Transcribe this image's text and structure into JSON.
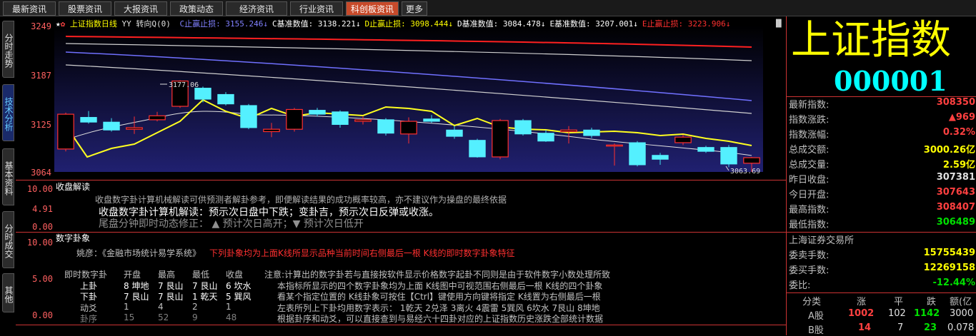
{
  "tabs": [
    {
      "label": "最新资讯"
    },
    {
      "label": "股票资讯"
    },
    {
      "label": "大报资讯"
    },
    {
      "label": "政策动态"
    },
    {
      "label": "经济资讯"
    },
    {
      "label": "行业资讯"
    },
    {
      "label": "科创板资讯"
    },
    {
      "label": "更多"
    }
  ],
  "side_tabs": [
    {
      "label": "分时走势"
    },
    {
      "label": "技术分析"
    },
    {
      "label": "基本资料"
    },
    {
      "label": "分时成交"
    },
    {
      "label": "其他"
    }
  ],
  "chart": {
    "title": "上证指数日线",
    "yy": "YY",
    "turn": "转向Q(0)",
    "legend": [
      {
        "label": "C止赢止损:",
        "value": "3155.246↓",
        "color": "#8080ff"
      },
      {
        "label": "C基准数值:",
        "value": "3138.221↓",
        "color": "#ffffff"
      },
      {
        "label": "D止赢止损:",
        "value": "3098.444↓",
        "color": "#ffff00"
      },
      {
        "label": "D基准数值:",
        "value": "3084.478↓",
        "color": "#ffffff"
      },
      {
        "label": "E基准数值:",
        "value": "3207.001↓",
        "color": "#ffffff"
      },
      {
        "label": "E止赢止损:",
        "value": "3223.906↓",
        "color": "#ff3030"
      }
    ],
    "y_ticks": [
      "3249",
      "3187",
      "3125",
      "3064"
    ],
    "high_label": "3177.06",
    "low_label": "3063.69"
  },
  "chart_data": {
    "type": "candlestick",
    "ylim": [
      3064,
      3249
    ],
    "candles": [
      {
        "o": 3093,
        "c": 3137,
        "h": 3139,
        "l": 3090
      },
      {
        "o": 3133,
        "c": 3127,
        "h": 3141,
        "l": 3125
      },
      {
        "o": 3127,
        "c": 3117,
        "h": 3132,
        "l": 3115
      },
      {
        "o": 3118,
        "c": 3120,
        "h": 3134,
        "l": 3112
      },
      {
        "o": 3130,
        "c": 3135,
        "h": 3140,
        "l": 3128
      },
      {
        "o": 3147,
        "c": 3179,
        "h": 3180,
        "l": 3145
      },
      {
        "o": 3170,
        "c": 3156,
        "h": 3172,
        "l": 3152
      },
      {
        "o": 3162,
        "c": 3150,
        "h": 3165,
        "l": 3148
      },
      {
        "o": 3148,
        "c": 3120,
        "h": 3150,
        "l": 3118
      },
      {
        "o": 3115,
        "c": 3118,
        "h": 3126,
        "l": 3108
      },
      {
        "o": 3118,
        "c": 3143,
        "h": 3145,
        "l": 3115
      },
      {
        "o": 3142,
        "c": 3137,
        "h": 3145,
        "l": 3134
      },
      {
        "o": 3140,
        "c": 3124,
        "h": 3142,
        "l": 3120
      },
      {
        "o": 3128,
        "c": 3130,
        "h": 3134,
        "l": 3124
      },
      {
        "o": 3130,
        "c": 3113,
        "h": 3132,
        "l": 3110
      },
      {
        "o": 3112,
        "c": 3128,
        "h": 3133,
        "l": 3100
      },
      {
        "o": 3131,
        "c": 3128,
        "h": 3136,
        "l": 3126
      },
      {
        "o": 3117,
        "c": 3109,
        "h": 3122,
        "l": 3106
      },
      {
        "o": 3104,
        "c": 3083,
        "h": 3106,
        "l": 3082
      },
      {
        "o": 3083,
        "c": 3129,
        "h": 3131,
        "l": 3080
      },
      {
        "o": 3129,
        "c": 3112,
        "h": 3131,
        "l": 3110
      },
      {
        "o": 3113,
        "c": 3103,
        "h": 3117,
        "l": 3102
      },
      {
        "o": 3115,
        "c": 3117,
        "h": 3122,
        "l": 3100
      },
      {
        "o": 3117,
        "c": 3110,
        "h": 3120,
        "l": 3107
      },
      {
        "o": 3098,
        "c": 3098,
        "h": 3100,
        "l": 3072
      },
      {
        "o": 3101,
        "c": 3073,
        "h": 3103,
        "l": 3071
      },
      {
        "o": 3085,
        "c": 3080,
        "h": 3088,
        "l": 3073
      },
      {
        "o": 3101,
        "c": 3108,
        "h": 3111,
        "l": 3098
      },
      {
        "o": 3095,
        "c": 3090,
        "h": 3097,
        "l": 3088
      },
      {
        "o": 3095,
        "c": 3074,
        "h": 3098,
        "l": 3070
      },
      {
        "o": 3075,
        "c": 3082,
        "h": 3083,
        "l": 3064
      }
    ]
  },
  "panel1": {
    "title": "收盘解读",
    "y_ticks": [
      "10.00",
      "4.91",
      "0.00"
    ],
    "line1": "收盘数字卦计算机械解读可供预测者解卦参考，即便解读结果的成功概率较高，亦不建议作为操盘的最终依据",
    "line2": "收盘数字卦计算机解读：预示次日盘中下跌；变卦吉，预示次日反弹或收涨。",
    "line3": "尾盘分钟即时动态修正：  ▲ 预计次日高开；▼ 预计次日低开"
  },
  "panel2": {
    "title": "数字卦象",
    "y_ticks": [
      "10.00",
      "5.00",
      "0.00"
    ],
    "intro_a": "姚彦：《金融市场统计易学系统》",
    "intro_b": "下列卦象均为上面K线所显示品种当前时间右侧最后一根 K线的即时数字卦象特征",
    "headers": [
      "即时数字卦",
      "开盘",
      "最高",
      "最低",
      "收盘"
    ],
    "rows": [
      {
        "name": "上卦",
        "c": [
          "8 坤地",
          "7 艮山",
          "7 艮山",
          "6 坎水"
        ]
      },
      {
        "name": "下卦",
        "c": [
          "7 艮山",
          "7 艮山",
          "1 乾天",
          "5 巽风"
        ]
      },
      {
        "name": "动爻",
        "c": [
          "1",
          "4",
          "2",
          "1"
        ]
      },
      {
        "name": "卦序",
        "c": [
          "15",
          "52",
          "9",
          "48"
        ]
      }
    ],
    "note": [
      "注意:计算出的数字卦若与直接按软件显示价格数字起卦不同则是由于软件数字小数处理所致",
      "本指标所显示的四个数字卦象均为上面 K线图中可视范围右侧最后一根 K线的四个卦象",
      "看某个指定位置的 K线卦象可按住【Ctrl】键使用方向键将指定 K线置为右侧最后一根",
      "左表所列上下卦均用数字表示：  1乾天 2兑泽 3离火 4震雷 5巽风 6坎水 7艮山 8坤地",
      "根据卦序和动爻，可以直接查到与易经六十四卦对应的上证指数历史涨跌全部统计数据"
    ]
  },
  "right": {
    "title": "上证指数",
    "code": "000001",
    "rows": [
      {
        "k": "最新指数:",
        "v": "308350",
        "color": "#ff4040"
      },
      {
        "k": "指数涨跌:",
        "v": "▲969",
        "color": "#ff4040"
      },
      {
        "k": "指数涨幅:",
        "v": "0.32%",
        "color": "#ff4040"
      },
      {
        "k": "总成交额:",
        "v": "3000.26亿",
        "color": "#ffff00"
      },
      {
        "k": "总成交量:",
        "v": "2.59亿",
        "color": "#ffff00"
      },
      {
        "k": "昨日收盘:",
        "v": "307381",
        "color": "#e0e0e0"
      },
      {
        "k": "今日开盘:",
        "v": "307643",
        "color": "#ff4040"
      },
      {
        "k": "最高指数:",
        "v": "308407",
        "color": "#ff4040"
      },
      {
        "k": "最低指数:",
        "v": "306489",
        "color": "#00e000"
      }
    ],
    "exchange": "上海证券交易所",
    "rows2": [
      {
        "k": "委卖手数:",
        "v": "15755439",
        "color": "#ffff00"
      },
      {
        "k": "委买手数:",
        "v": "12269158",
        "color": "#ffff00"
      },
      {
        "k": "委比:",
        "v": "-12.44%",
        "color": "#00e000"
      }
    ],
    "table_headers": [
      "分类",
      "涨",
      "平",
      "跌",
      "额(亿"
    ],
    "table_rows": [
      {
        "c": [
          "A股",
          "1002",
          "102",
          "1142",
          "3000"
        ]
      },
      {
        "c": [
          "B股",
          "14",
          "7",
          "23",
          "0.078"
        ]
      }
    ]
  }
}
